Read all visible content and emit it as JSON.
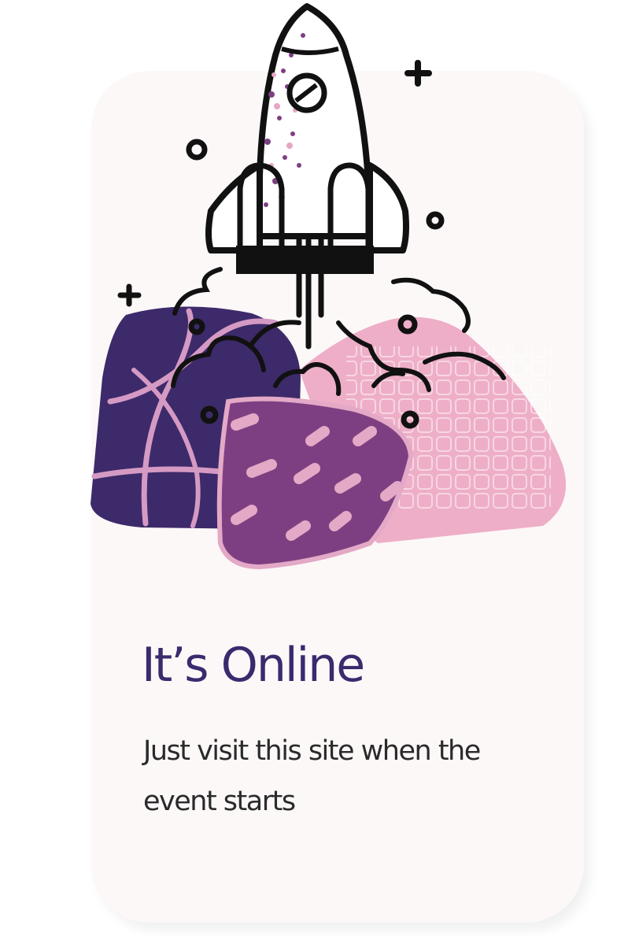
{
  "card": {
    "title": "It’s Online",
    "description": "Just visit this site when the event starts"
  },
  "colors": {
    "card_background": "#fcf8f8",
    "title": "#3b2a6e",
    "description": "#2a2a2a",
    "dark_purple": "#3d2a6a",
    "mid_purple": "#7e3f82",
    "pink": "#eeaec7",
    "ink": "#111111"
  },
  "icons": [
    "rocket-icon",
    "sparkle-icon",
    "circle-icon"
  ]
}
